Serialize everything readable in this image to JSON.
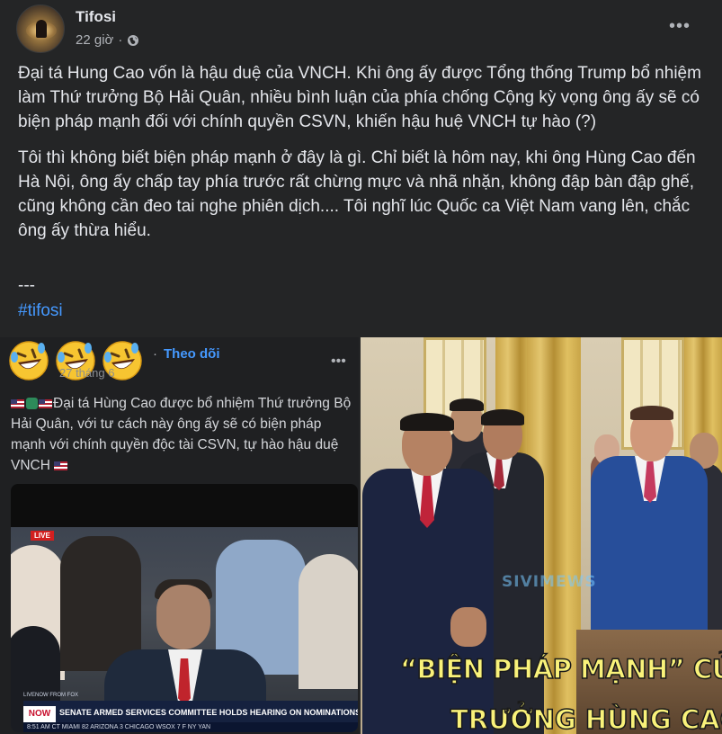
{
  "post": {
    "author": "Tifosi",
    "time": "22 giờ",
    "separator": "·",
    "privacy_icon": "globe-icon",
    "more_label": "•••",
    "paragraphs": [
      "Đại tá Hung Cao vốn là hậu duệ của VNCH. Khi ông ấy được Tổng thống Trump bổ nhiệm làm Thứ trưởng Bộ Hải Quân, nhiều bình luận của phía chống Cộng kỳ vọng ông ấy sẽ có biện pháp mạnh đối với chính quyền CSVN, khiến hậu huệ VNCH tự hào (?)",
      "Tôi thì không biết biện pháp mạnh ở đây là gì. Chỉ biết là hôm nay, khi ông Hùng Cao đến Hà Nội, ông ấy chấp tay phía trước rất chừng mực và nhã nhặn, không đập bàn đập ghế, cũng không cần đeo tai nghe phiên dịch.... Tôi nghĩ lúc Quốc ca Việt Nam vang lên, chắc ông ấy thừa hiểu."
    ],
    "divider": "---",
    "hashtag": "#tifosi"
  },
  "embed": {
    "emoji_icon": "rolling-laughing-emoji-icon",
    "follow_sep": "·",
    "follow_label": "Theo dõi",
    "date": "27 tháng 6",
    "more_label": "•••",
    "text": "Đại tá Hùng Cao được bổ nhiệm Thứ trưởng Bộ Hải Quân, với tư cách này ông ấy sẽ có biện pháp mạnh với chính quyền độc tài CSVN, tự hào hậu duệ VNCH",
    "video": {
      "live_tag": "LIVE",
      "lower_third_top": "LIVENOW FROM FOX",
      "now_label": "NOW",
      "headline": "SENATE ARMED SERVICES COMMITTEE HOLDS HEARING ON NOMINATIONS",
      "ticker": "8:51 AM CT   MIAMI 82   ARIZONA 3   CHICAGO WSOX 7   F NY YAN"
    }
  },
  "photo": {
    "watermark": "SIVIMEWS",
    "caption_line1": "“BIỆN PHÁP MẠNH” CỦA THỨ",
    "caption_line2": "TRƯỞNG HÙNG CAO"
  }
}
